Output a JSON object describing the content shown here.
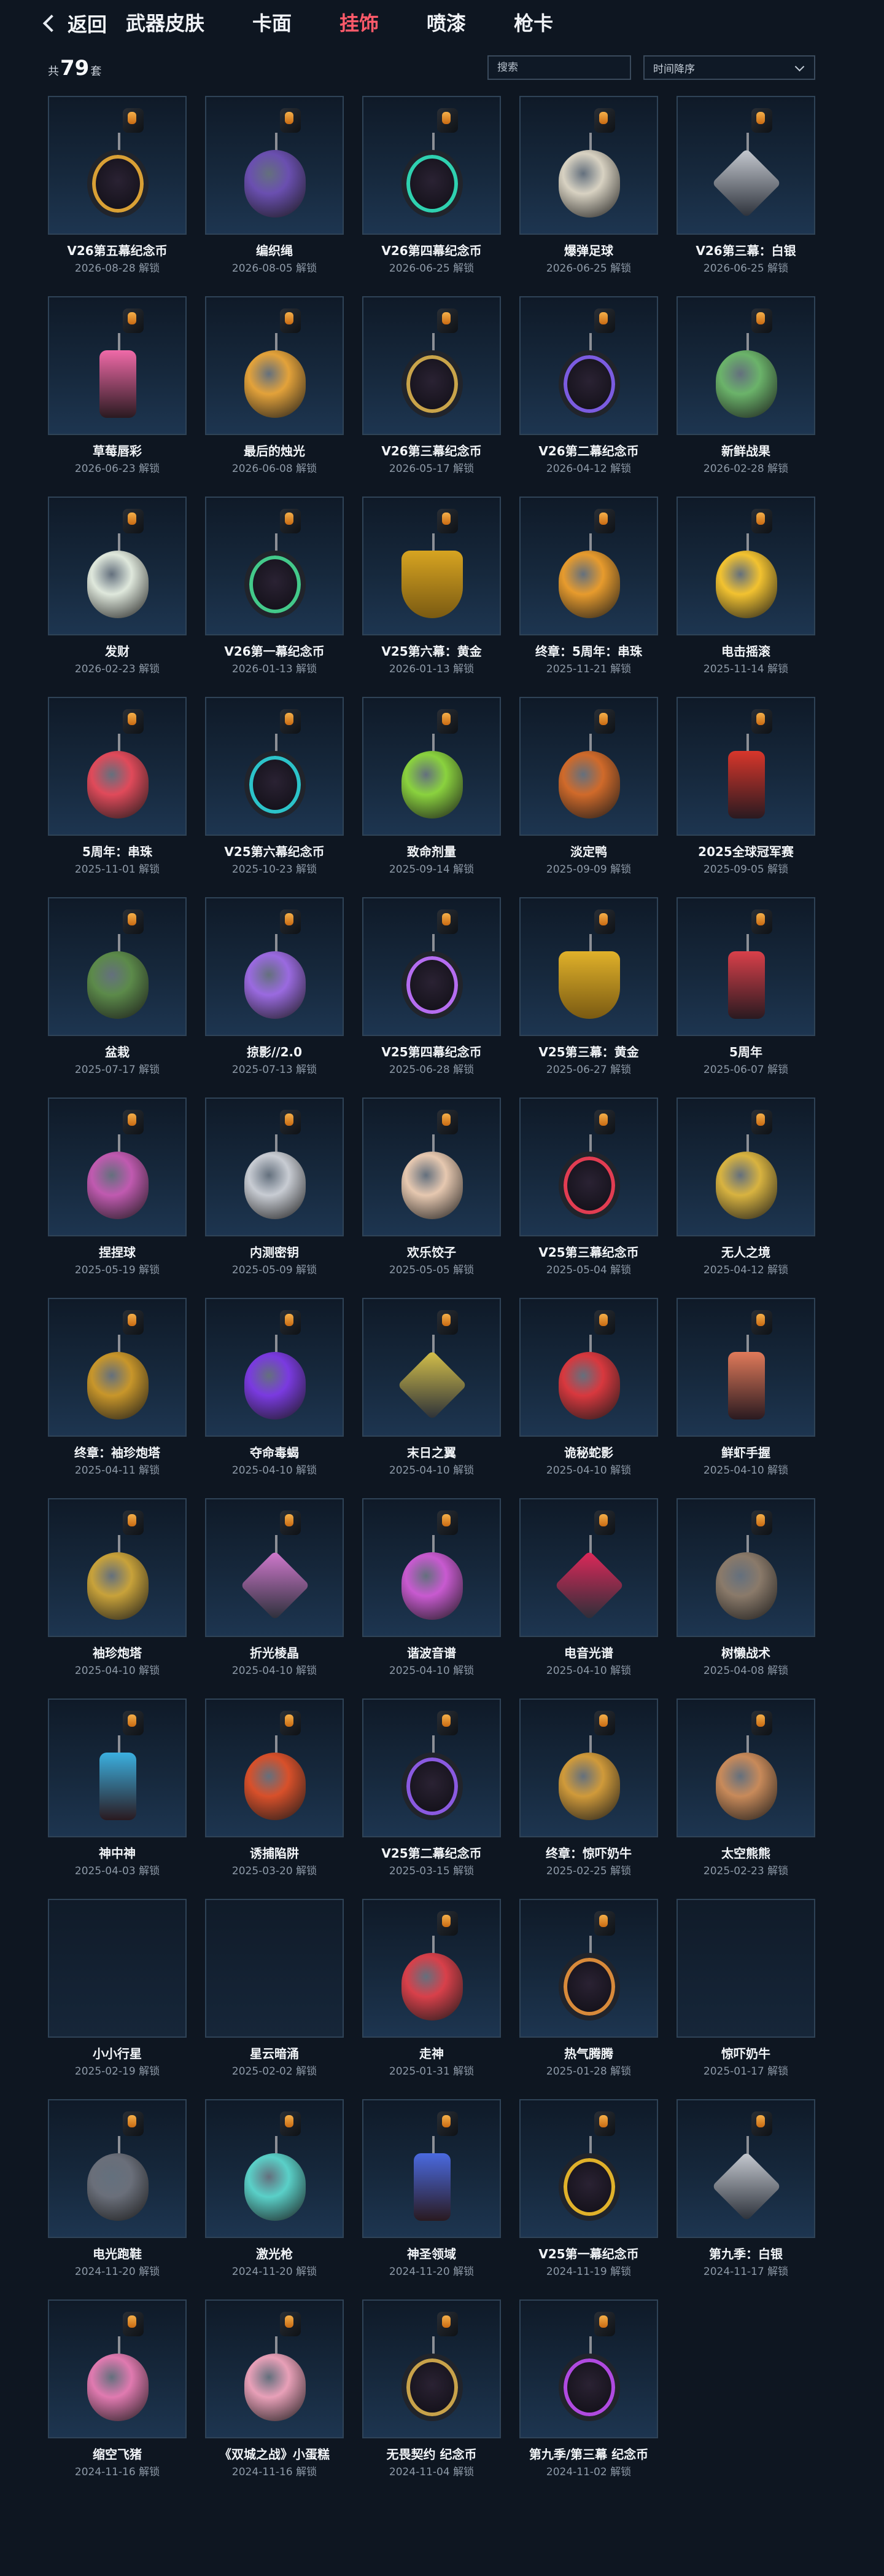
{
  "nav": {
    "back_label": "返回",
    "tabs": [
      "武器皮肤",
      "卡面",
      "挂饰",
      "喷漆",
      "枪卡"
    ],
    "active_tab": 2
  },
  "toolbar": {
    "count_prefix": "共",
    "count": "79",
    "count_suffix": "套",
    "search_placeholder": "搜索",
    "sort_value": "时间降序"
  },
  "items": [
    {
      "name": "V26第五幕纪念币",
      "date": "2026-08-28 解锁",
      "color": "#d9a035",
      "shape": "coin"
    },
    {
      "name": "编织绳",
      "date": "2026-08-05 解锁",
      "color": "#6a4fb0",
      "shape": "rope"
    },
    {
      "name": "V26第四幕纪念币",
      "date": "2026-06-25 解锁",
      "color": "#2fd1b0",
      "shape": "coin"
    },
    {
      "name": "爆弹足球",
      "date": "2026-06-25 解锁",
      "color": "#d8d2c2",
      "shape": "ball"
    },
    {
      "name": "V26第三幕：白银",
      "date": "2026-06-25 解锁",
      "color": "#c8ccd3",
      "shape": "diamond"
    },
    {
      "name": "草莓唇彩",
      "date": "2026-06-23 解锁",
      "color": "#f06aa8",
      "shape": "tube"
    },
    {
      "name": "最后的烛光",
      "date": "2026-06-08 解锁",
      "color": "#e3a23a",
      "shape": "candle"
    },
    {
      "name": "V26第三幕纪念币",
      "date": "2026-05-17 解锁",
      "color": "#c9a44a",
      "shape": "coin"
    },
    {
      "name": "V26第二幕纪念币",
      "date": "2026-04-12 解锁",
      "color": "#7b5ce0",
      "shape": "coin"
    },
    {
      "name": "新鲜战果",
      "date": "2026-02-28 解锁",
      "color": "#6bb36a",
      "shape": "flower"
    },
    {
      "name": "发财",
      "date": "2026-02-23 解锁",
      "color": "#dfe8dc",
      "shape": "tile"
    },
    {
      "name": "V26第一幕纪念币",
      "date": "2026-01-13 解锁",
      "color": "#43c98a",
      "shape": "coin"
    },
    {
      "name": "V25第六幕：黄金",
      "date": "2026-01-13 解锁",
      "color": "#d7a421",
      "shape": "shield"
    },
    {
      "name": "终章：5周年：串珠",
      "date": "2025-11-21 解锁",
      "color": "#e79b2d",
      "shape": "ring"
    },
    {
      "name": "电击摇滚",
      "date": "2025-11-14 解锁",
      "color": "#f2c230",
      "shape": "bolt"
    },
    {
      "name": "5周年：串珠",
      "date": "2025-11-01 解锁",
      "color": "#e04a5a",
      "shape": "ring"
    },
    {
      "name": "V25第六幕纪念币",
      "date": "2025-10-23 解锁",
      "color": "#2cc3c9",
      "shape": "coin"
    },
    {
      "name": "致命剂量",
      "date": "2025-09-14 解锁",
      "color": "#8ad23e",
      "shape": "blob"
    },
    {
      "name": "淡定鸭",
      "date": "2025-09-09 解锁",
      "color": "#d06a2a",
      "shape": "ball"
    },
    {
      "name": "2025全球冠军赛",
      "date": "2025-09-05 解锁",
      "color": "#d8362b",
      "shape": "tag"
    },
    {
      "name": "盆栽",
      "date": "2025-07-17 解锁",
      "color": "#5c8a4a",
      "shape": "tree"
    },
    {
      "name": "掠影//2.0",
      "date": "2025-07-13 解锁",
      "color": "#9a6ae0",
      "shape": "orb"
    },
    {
      "name": "V25第四幕纪念币",
      "date": "2025-06-28 解锁",
      "color": "#b56df0",
      "shape": "coin"
    },
    {
      "name": "V25第三幕：黄金",
      "date": "2025-06-27 解锁",
      "color": "#e0b12a",
      "shape": "shield"
    },
    {
      "name": "5周年",
      "date": "2025-06-07 解锁",
      "color": "#d9404a",
      "shape": "tag"
    },
    {
      "name": "捏捏球",
      "date": "2025-05-19 解锁",
      "color": "#c05ab0",
      "shape": "ball"
    },
    {
      "name": "内测密钥",
      "date": "2025-05-09 解锁",
      "color": "#c8ccd3",
      "shape": "key"
    },
    {
      "name": "欢乐饺子",
      "date": "2025-05-05 解锁",
      "color": "#e6c8b0",
      "shape": "blob"
    },
    {
      "name": "V25第三幕纪念币",
      "date": "2025-05-04 解锁",
      "color": "#e23d52",
      "shape": "coin"
    },
    {
      "name": "无人之境",
      "date": "2025-04-12 解锁",
      "color": "#d8b340",
      "shape": "robot"
    },
    {
      "name": "终章：袖珍炮塔",
      "date": "2025-04-11 解锁",
      "color": "#c8962a",
      "shape": "ball"
    },
    {
      "name": "夺命毒蝎",
      "date": "2025-04-10 解锁",
      "color": "#7a3ae0",
      "shape": "scorpion"
    },
    {
      "name": "末日之翼",
      "date": "2025-04-10 解锁",
      "color": "#d7c24a",
      "shape": "diamond"
    },
    {
      "name": "诡秘蛇影",
      "date": "2025-04-10 解锁",
      "color": "#d8383e",
      "shape": "fang"
    },
    {
      "name": "鲜虾手握",
      "date": "2025-04-10 解锁",
      "color": "#e07a5a",
      "shape": "tag"
    },
    {
      "name": "袖珍炮塔",
      "date": "2025-04-10 解锁",
      "color": "#c8a23a",
      "shape": "ball"
    },
    {
      "name": "折光棱晶",
      "date": "2025-04-10 解锁",
      "color": "#d37ad0",
      "shape": "diamond"
    },
    {
      "name": "谐波音谱",
      "date": "2025-04-10 解锁",
      "color": "#c85ad0",
      "shape": "can"
    },
    {
      "name": "电音光谱",
      "date": "2025-04-10 解锁",
      "color": "#e0285a",
      "shape": "diamond"
    },
    {
      "name": "树懒战术",
      "date": "2025-04-08 解锁",
      "color": "#8a7a6a",
      "shape": "blob"
    },
    {
      "name": "神中神",
      "date": "2025-04-03 解锁",
      "color": "#3bb0e0",
      "shape": "blade"
    },
    {
      "name": "诱捕陷阱",
      "date": "2025-03-20 解锁",
      "color": "#d8502a",
      "shape": "flower"
    },
    {
      "name": "V25第二幕纪念币",
      "date": "2025-03-15 解锁",
      "color": "#8a5ae0",
      "shape": "coin"
    },
    {
      "name": "终章：惊吓奶牛",
      "date": "2025-02-25 解锁",
      "color": "#d09a3a",
      "shape": "blob"
    },
    {
      "name": "太空熊熊",
      "date": "2025-02-23 解锁",
      "color": "#c88a5a",
      "shape": "bear"
    },
    {
      "name": "小小行星",
      "date": "2025-02-19 解锁",
      "color": "",
      "shape": "none"
    },
    {
      "name": "星云暗涌",
      "date": "2025-02-02 解锁",
      "color": "",
      "shape": "none"
    },
    {
      "name": "走神",
      "date": "2025-01-31 解锁",
      "color": "#d8404a",
      "shape": "blob"
    },
    {
      "name": "热气腾腾",
      "date": "2025-01-28 解锁",
      "color": "#d88a3a",
      "shape": "coin"
    },
    {
      "name": "惊吓奶牛",
      "date": "2025-01-17 解锁",
      "color": "",
      "shape": "none"
    },
    {
      "name": "电光跑鞋",
      "date": "2024-11-20 解锁",
      "color": "#6a6f7a",
      "shape": "shoe"
    },
    {
      "name": "激光枪",
      "date": "2024-11-20 解锁",
      "color": "#5ad0c8",
      "shape": "gun"
    },
    {
      "name": "神圣领域",
      "date": "2024-11-20 解锁",
      "color": "#4a6ae0",
      "shape": "tag"
    },
    {
      "name": "V25第一幕纪念币",
      "date": "2024-11-19 解锁",
      "color": "#e0b12a",
      "shape": "coin"
    },
    {
      "name": "第九季：白银",
      "date": "2024-11-17 解锁",
      "color": "#c8ccd3",
      "shape": "diamond"
    },
    {
      "name": "缩空飞猪",
      "date": "2024-11-16 解锁",
      "color": "#e07ab0",
      "shape": "ball"
    },
    {
      "name": "《双城之战》小蛋糕",
      "date": "2024-11-16 解锁",
      "color": "#e8a0b8",
      "shape": "blob"
    },
    {
      "name": "无畏契约 纪念币",
      "date": "2024-11-04 解锁",
      "color": "#c8a24a",
      "shape": "coin"
    },
    {
      "name": "第九季/第三幕 纪念币",
      "date": "2024-11-02 解锁",
      "color": "#b04ae0",
      "shape": "coin"
    }
  ]
}
